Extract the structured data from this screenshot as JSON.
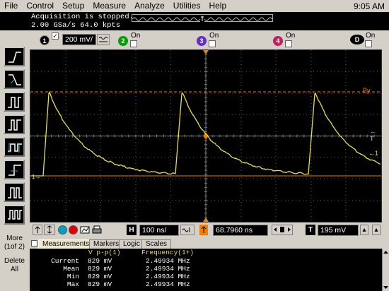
{
  "menubar": {
    "items": [
      "File",
      "Control",
      "Setup",
      "Measure",
      "Analyze",
      "Utilities",
      "Help"
    ],
    "clock": "9:05 AM"
  },
  "status": {
    "line1": "Acquisition is stopped.",
    "line2": "2.00 GSa/s   64.0 kpts"
  },
  "channels": {
    "ch1": {
      "number": "1",
      "checked_mark": "✓",
      "scale": "200 mV/",
      "color": "#d8c800"
    },
    "ch2": {
      "number": "2",
      "on_label": "On",
      "color": "#00a000"
    },
    "ch3": {
      "number": "3",
      "on_label": "On",
      "color": "#6030c0"
    },
    "ch4": {
      "number": "4",
      "on_label": "On",
      "color": "#c02060"
    },
    "ch_d": {
      "label": "D",
      "on_label": "On"
    }
  },
  "side": {
    "more": "More\n(1of 2)",
    "delete": "Delete\nAll"
  },
  "screen_labels": {
    "by_marker": "By",
    "t_marker": "← T",
    "ch1_marker": "1",
    "left_marker": "1→"
  },
  "controls": {
    "timebase": "100 ns/",
    "position": "68.7960 ns",
    "trigger_level": "195 mV",
    "h_label": "H",
    "t_label": "T"
  },
  "tabs": [
    "Measurements",
    "Markers",
    "Logic",
    "Scales"
  ],
  "measurements": {
    "header_col1": "V p-p(1)",
    "header_col2": "Frequency(1+)",
    "rows": [
      {
        "label": "Current",
        "vpp": "829 mV",
        "freq": "2.49934 MHz"
      },
      {
        "label": "Mean",
        "vpp": "829 mV",
        "freq": "2.49934 MHz"
      },
      {
        "label": "Min",
        "vpp": "829 mV",
        "freq": "2.49934 MHz"
      },
      {
        "label": "Max",
        "vpp": "829 mV",
        "freq": "2.49934 MHz"
      }
    ]
  },
  "colors": {
    "trace": "#e8e040",
    "marker_orange": "#f08000",
    "grid": "#606060"
  }
}
